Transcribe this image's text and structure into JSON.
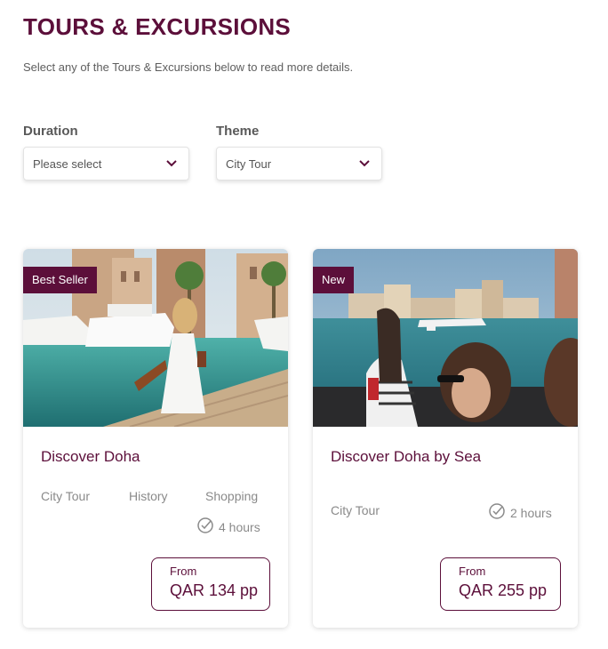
{
  "header": {
    "title": "TOURS & EXCURSIONS",
    "subtitle": "Select any of the Tours & Excursions below to read more details."
  },
  "filters": {
    "duration": {
      "label": "Duration",
      "value": "Please select",
      "icon": "chevron-down-icon"
    },
    "theme": {
      "label": "Theme",
      "value": "City Tour",
      "icon": "chevron-down-icon"
    }
  },
  "cards": [
    {
      "badge": "Best Seller",
      "title": "Discover Doha",
      "tags": [
        "City Tour",
        "History",
        "Shopping"
      ],
      "duration": "4 hours",
      "price_from": "From",
      "price": "QAR 134 pp"
    },
    {
      "badge": "New",
      "title": "Discover Doha by Sea",
      "tags": [
        "City Tour"
      ],
      "duration": "2 hours",
      "price_from": "From",
      "price": "QAR 255 pp"
    }
  ],
  "colors": {
    "brand": "#5c0f3a",
    "text_muted": "#8a8a8a",
    "water": "#2f8f8f"
  }
}
